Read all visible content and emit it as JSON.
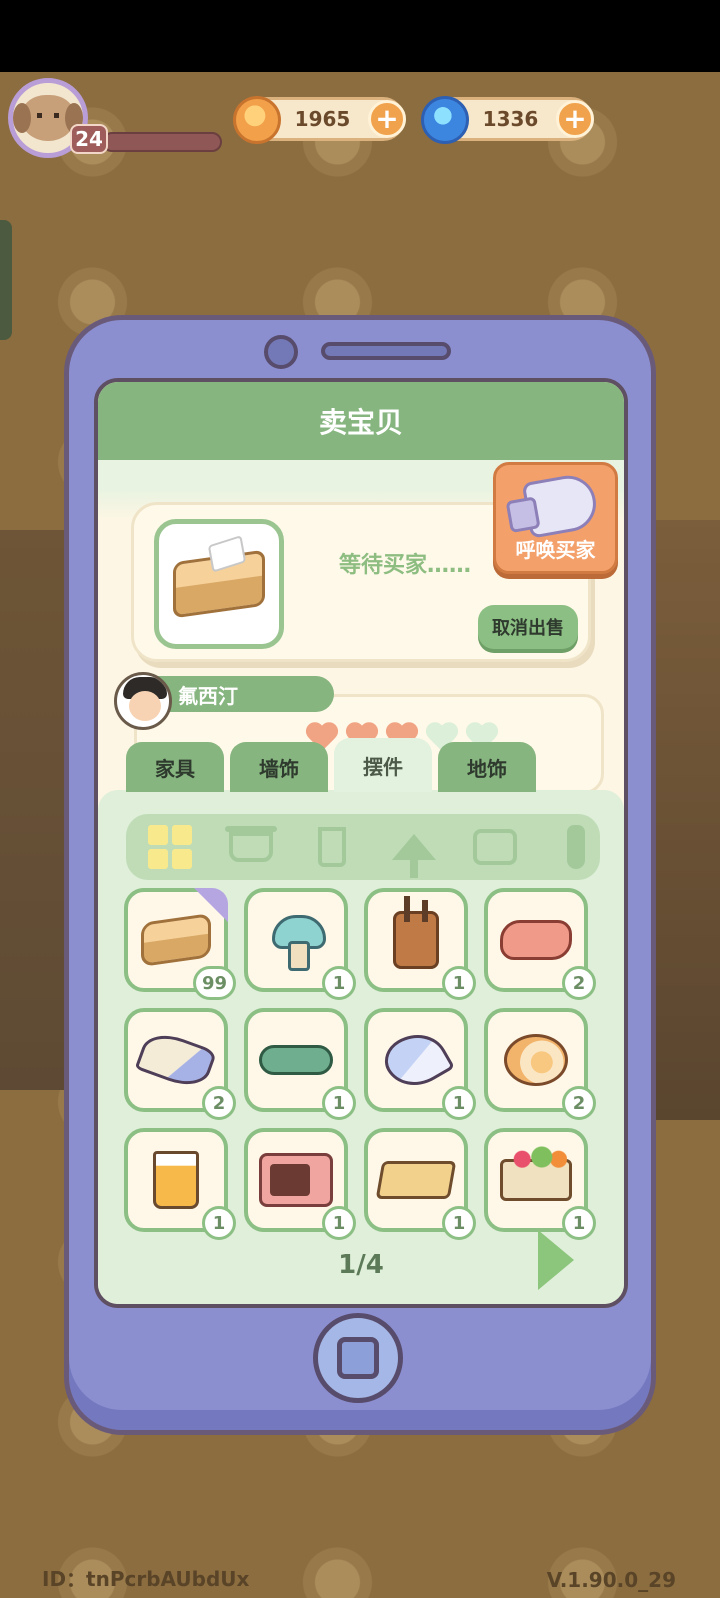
{
  "hud": {
    "level": "24",
    "coins": "1965",
    "gems": "1336",
    "coin_icon": "coin-icon",
    "gem_icon": "swirl-gem-icon"
  },
  "screen": {
    "title": "卖宝贝",
    "sale": {
      "status": "等待买家……",
      "cancel_label": "取消出售",
      "call_buyer_label": "呼唤买家"
    },
    "buyer": {
      "name": "氟西汀",
      "hearts_full": 3,
      "hearts_total": 5
    },
    "tabs": [
      {
        "label": "家具",
        "active": false
      },
      {
        "label": "墙饰",
        "active": false
      },
      {
        "label": "摆件",
        "active": true
      },
      {
        "label": "地饰",
        "active": false
      }
    ],
    "filters": [
      "grid-all-icon",
      "pot-icon",
      "cup-icon",
      "lamp-icon",
      "pillow-icon",
      "vase-icon"
    ],
    "items": [
      {
        "icon": "tissue-box-icon",
        "count": "99"
      },
      {
        "icon": "mushroom-icon",
        "count": "1"
      },
      {
        "icon": "pen-holder-icon",
        "count": "1"
      },
      {
        "icon": "meat-icon",
        "count": "2"
      },
      {
        "icon": "conch-shell-icon",
        "count": "2"
      },
      {
        "icon": "lizard-icon",
        "count": "1"
      },
      {
        "icon": "spiral-shell-icon",
        "count": "1"
      },
      {
        "icon": "nautilus-shell-icon",
        "count": "2"
      },
      {
        "icon": "drink-icon",
        "count": "1"
      },
      {
        "icon": "microwave-icon",
        "count": "1"
      },
      {
        "icon": "tray-icon",
        "count": "1"
      },
      {
        "icon": "veggie-basket-icon",
        "count": "1"
      }
    ],
    "page": "1/4"
  },
  "footer": {
    "id": "ID：tnPcrbAUbdUx",
    "version": "V.1.90.0_29"
  }
}
